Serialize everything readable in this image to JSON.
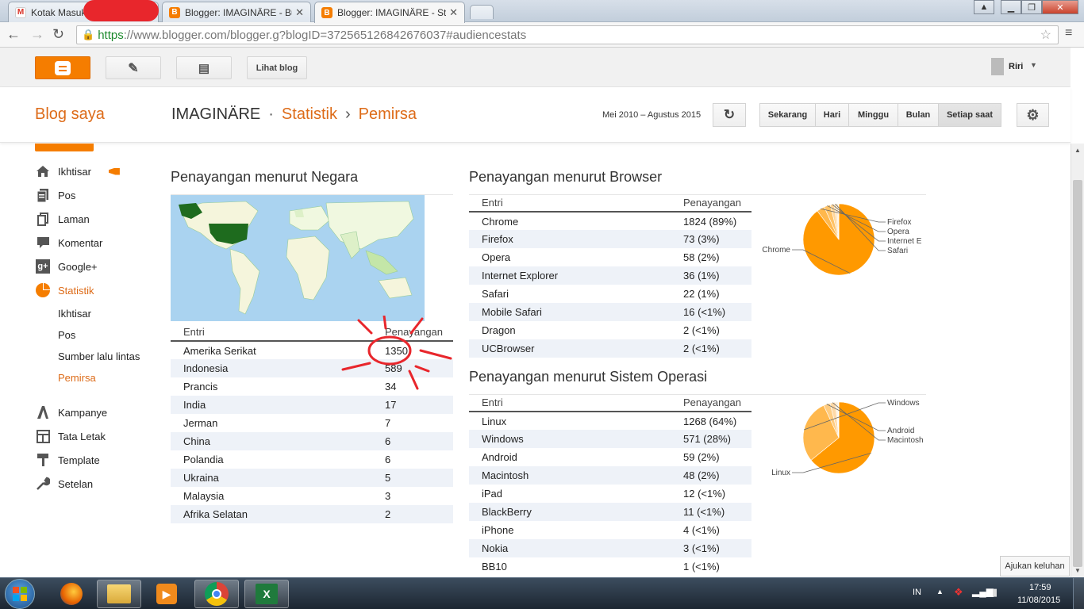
{
  "browser": {
    "tabs": [
      {
        "title": "Kotak Masuk",
        "icon": "gmail-icon"
      },
      {
        "title": "Blogger: IMAGINÄRE - Bu",
        "icon": "blogger-icon"
      },
      {
        "title": "Blogger: IMAGINÄRE - Sta",
        "icon": "blogger-icon"
      }
    ],
    "url_scheme": "https",
    "url_rest": "://www.blogger.com/blogger.g?blogID=372565126842676037#audiencestats"
  },
  "topbar": {
    "view_blog_label": "Lihat blog",
    "user_name": "Riri"
  },
  "header": {
    "my_blogs": "Blog saya",
    "blog_name": "IMAGINÄRE",
    "sep1": "·",
    "crumb_stats": "Statistik",
    "sep2": "›",
    "crumb_audience": "Pemirsa",
    "date_range": "Mei 2010 – Agustus 2015",
    "ranges": [
      "Sekarang",
      "Hari",
      "Minggu",
      "Bulan",
      "Setiap saat"
    ]
  },
  "sidebar": {
    "items": [
      {
        "label": "Ikhtisar",
        "icon": "home-icon"
      },
      {
        "label": "Pos",
        "icon": "posts-icon"
      },
      {
        "label": "Laman",
        "icon": "pages-icon"
      },
      {
        "label": "Komentar",
        "icon": "comment-icon"
      },
      {
        "label": "Google+",
        "icon": "google-plus-icon"
      },
      {
        "label": "Statistik",
        "icon": "pie-chart-icon"
      }
    ],
    "subitems": [
      "Ikhtisar",
      "Pos",
      "Sumber lalu lintas",
      "Pemirsa"
    ],
    "items2": [
      {
        "label": "Kampanye",
        "icon": "campaign-icon"
      },
      {
        "label": "Tata Letak",
        "icon": "layout-icon"
      },
      {
        "label": "Template",
        "icon": "template-icon"
      },
      {
        "label": "Setelan",
        "icon": "wrench-icon"
      }
    ]
  },
  "country": {
    "title": "Penayangan menurut Negara",
    "col1": "Entri",
    "col2": "Penayangan",
    "rows": [
      [
        "Amerika Serikat",
        "1350"
      ],
      [
        "Indonesia",
        "589"
      ],
      [
        "Prancis",
        "34"
      ],
      [
        "India",
        "17"
      ],
      [
        "Jerman",
        "7"
      ],
      [
        "China",
        "6"
      ],
      [
        "Polandia",
        "6"
      ],
      [
        "Ukraina",
        "5"
      ],
      [
        "Malaysia",
        "3"
      ],
      [
        "Afrika Selatan",
        "2"
      ]
    ]
  },
  "browsers": {
    "title": "Penayangan menurut Browser",
    "col1": "Entri",
    "col2": "Penayangan",
    "rows": [
      [
        "Chrome",
        "1824 (89%)"
      ],
      [
        "Firefox",
        "73 (3%)"
      ],
      [
        "Opera",
        "58 (2%)"
      ],
      [
        "Internet Explorer",
        "36 (1%)"
      ],
      [
        "Safari",
        "22 (1%)"
      ],
      [
        "Mobile Safari",
        "16 (<1%)"
      ],
      [
        "Dragon",
        "2 (<1%)"
      ],
      [
        "UCBrowser",
        "2 (<1%)"
      ]
    ],
    "pie_labels": [
      "Chrome",
      "Firefox",
      "Opera",
      "Internet E",
      "Safari"
    ]
  },
  "os": {
    "title": "Penayangan menurut Sistem Operasi",
    "col1": "Entri",
    "col2": "Penayangan",
    "rows": [
      [
        "Linux",
        "1268 (64%)"
      ],
      [
        "Windows",
        "571 (28%)"
      ],
      [
        "Android",
        "59 (2%)"
      ],
      [
        "Macintosh",
        "48 (2%)"
      ],
      [
        "iPad",
        "12 (<1%)"
      ],
      [
        "BlackBerry",
        "11 (<1%)"
      ],
      [
        "iPhone",
        "4 (<1%)"
      ],
      [
        "Nokia",
        "3 (<1%)"
      ],
      [
        "BB10",
        "1 (<1%)"
      ]
    ],
    "pie_labels": [
      "Linux",
      "Windows",
      "Android",
      "Macintosh"
    ]
  },
  "chart_data": [
    {
      "type": "pie",
      "title": "",
      "categories": [
        "Chrome",
        "Firefox",
        "Opera",
        "Internet Explorer",
        "Safari",
        "Mobile Safari",
        "Dragon",
        "UCBrowser"
      ],
      "values": [
        1824,
        73,
        58,
        36,
        22,
        16,
        2,
        2
      ],
      "colors": [
        "#ff9900",
        "#ffb84d",
        "#ffc266",
        "#ffd699",
        "#ffe0b3",
        "#ffe8c7",
        "#fff0db",
        "#fff5e6"
      ]
    },
    {
      "type": "pie",
      "title": "",
      "categories": [
        "Linux",
        "Windows",
        "Android",
        "Macintosh",
        "iPad",
        "BlackBerry",
        "iPhone",
        "Nokia",
        "BB10"
      ],
      "values": [
        1268,
        571,
        59,
        48,
        12,
        11,
        4,
        3,
        1
      ],
      "colors": [
        "#ff9900",
        "#ffb84d",
        "#ffcc80",
        "#ffd9a6",
        "#ffe4bf",
        "#ffeacc",
        "#fff0db",
        "#fff5e6",
        "#fffaf0"
      ]
    }
  ],
  "feedback_label": "Ajukan keluhan",
  "taskbar": {
    "lang": "IN",
    "time": "17:59",
    "date": "11/08/2015"
  },
  "colors": {
    "accent": "#f57d00",
    "link": "#dd6b18",
    "taskbar": "#1c2631"
  }
}
